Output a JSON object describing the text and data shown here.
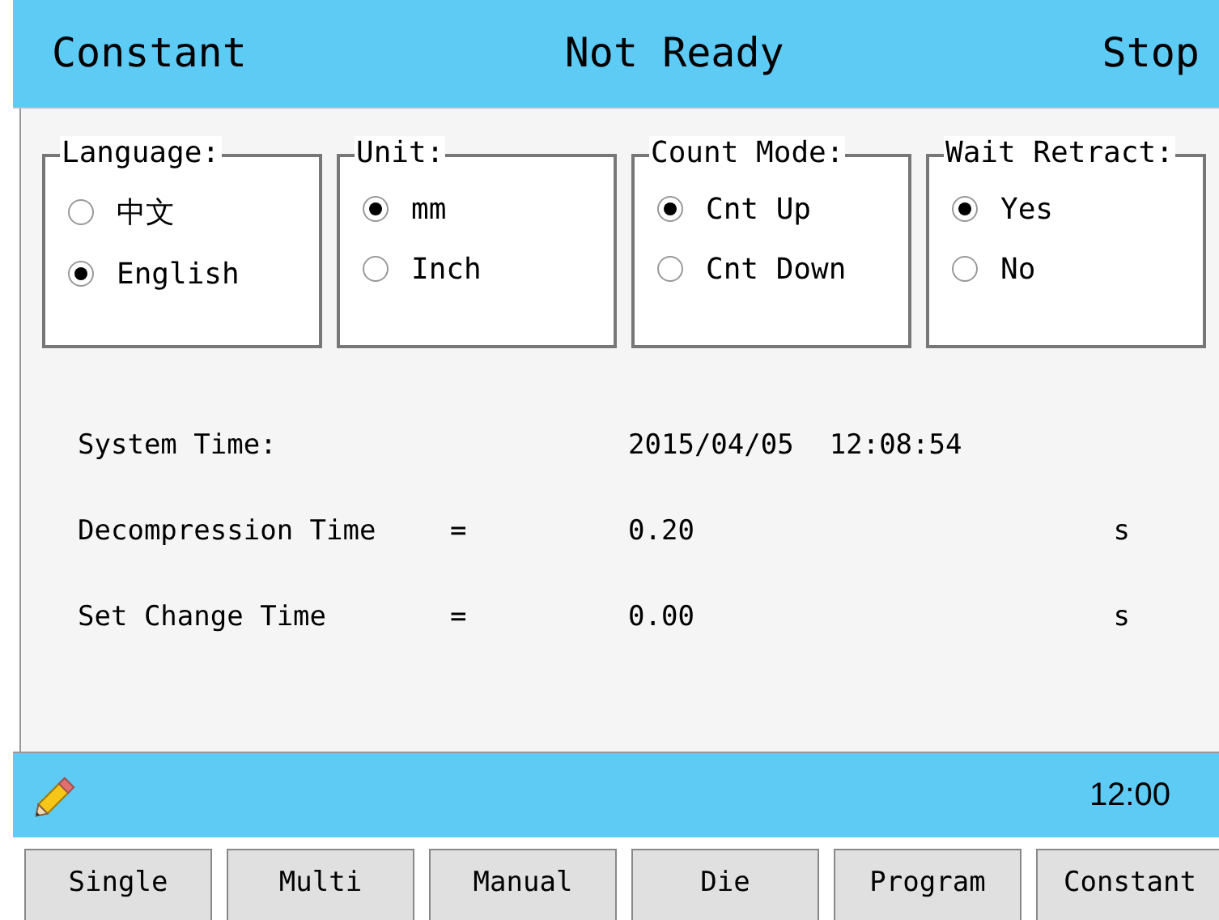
{
  "header": {
    "mode": "Constant",
    "status": "Not Ready",
    "state": "Stop"
  },
  "option_groups": [
    {
      "label": "Language:",
      "options": [
        {
          "label": "中文",
          "selected": false
        },
        {
          "label": "English",
          "selected": true
        }
      ]
    },
    {
      "label": "Unit:",
      "options": [
        {
          "label": "mm",
          "selected": true
        },
        {
          "label": "Inch",
          "selected": false
        }
      ]
    },
    {
      "label": "Count Mode:",
      "options": [
        {
          "label": "Cnt Up",
          "selected": true
        },
        {
          "label": "Cnt Down",
          "selected": false
        }
      ]
    },
    {
      "label": "Wait Retract:",
      "options": [
        {
          "label": "Yes",
          "selected": true
        },
        {
          "label": "No",
          "selected": false
        }
      ]
    }
  ],
  "settings": [
    {
      "label": "System Time:",
      "values": [
        "2015/04/05",
        "12:08:54"
      ]
    },
    {
      "label": "Decompression Time",
      "separator": "=",
      "values": [
        "0.20"
      ],
      "unit": "s"
    },
    {
      "label": "Set Change Time",
      "separator": "=",
      "values": [
        "0.00"
      ],
      "unit": "s"
    }
  ],
  "status_bar": {
    "time": "12:00"
  },
  "nav_buttons": [
    "Single",
    "Multi",
    "Manual",
    "Die",
    "Program",
    "Constant"
  ]
}
